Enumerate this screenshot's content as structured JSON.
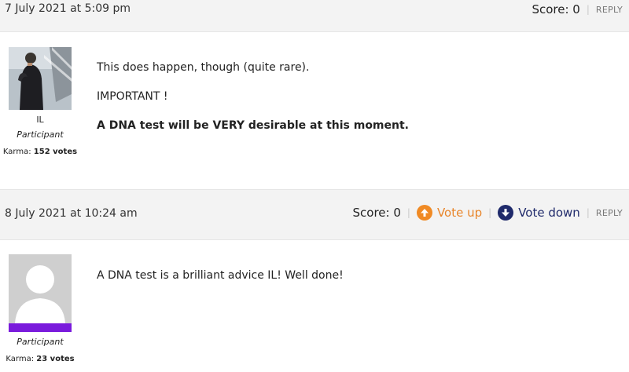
{
  "comments": [
    {
      "date": "7 July 2021 at 5:09 pm",
      "score_label": "Score: 0",
      "reply_label": "REPLY",
      "author": "IL",
      "role": "Participant",
      "karma_label": "Karma:",
      "karma_value": "152 votes",
      "paragraphs": [
        "This does happen, though (quite rare).",
        "IMPORTANT !",
        "A DNA test will be VERY desirable at this moment."
      ]
    },
    {
      "date": "8 July 2021 at 10:24 am",
      "score_label": "Score: 0",
      "vote_up_label": "Vote up",
      "vote_down_label": "Vote down",
      "reply_label": "REPLY",
      "author": "",
      "role": "Participant",
      "karma_label": "Karma:",
      "karma_value": "23 votes",
      "paragraphs": [
        "A DNA test is a brilliant advice IL! Well done!"
      ]
    }
  ],
  "colors": {
    "header_bg": "#f3f3f3",
    "vote_up": "#f08a24",
    "vote_down": "#1f2a6b",
    "role_bar": "#7a1bdc"
  },
  "icons": {
    "vote_up": "arrow-up-circle-icon",
    "vote_down": "arrow-down-circle-icon"
  }
}
